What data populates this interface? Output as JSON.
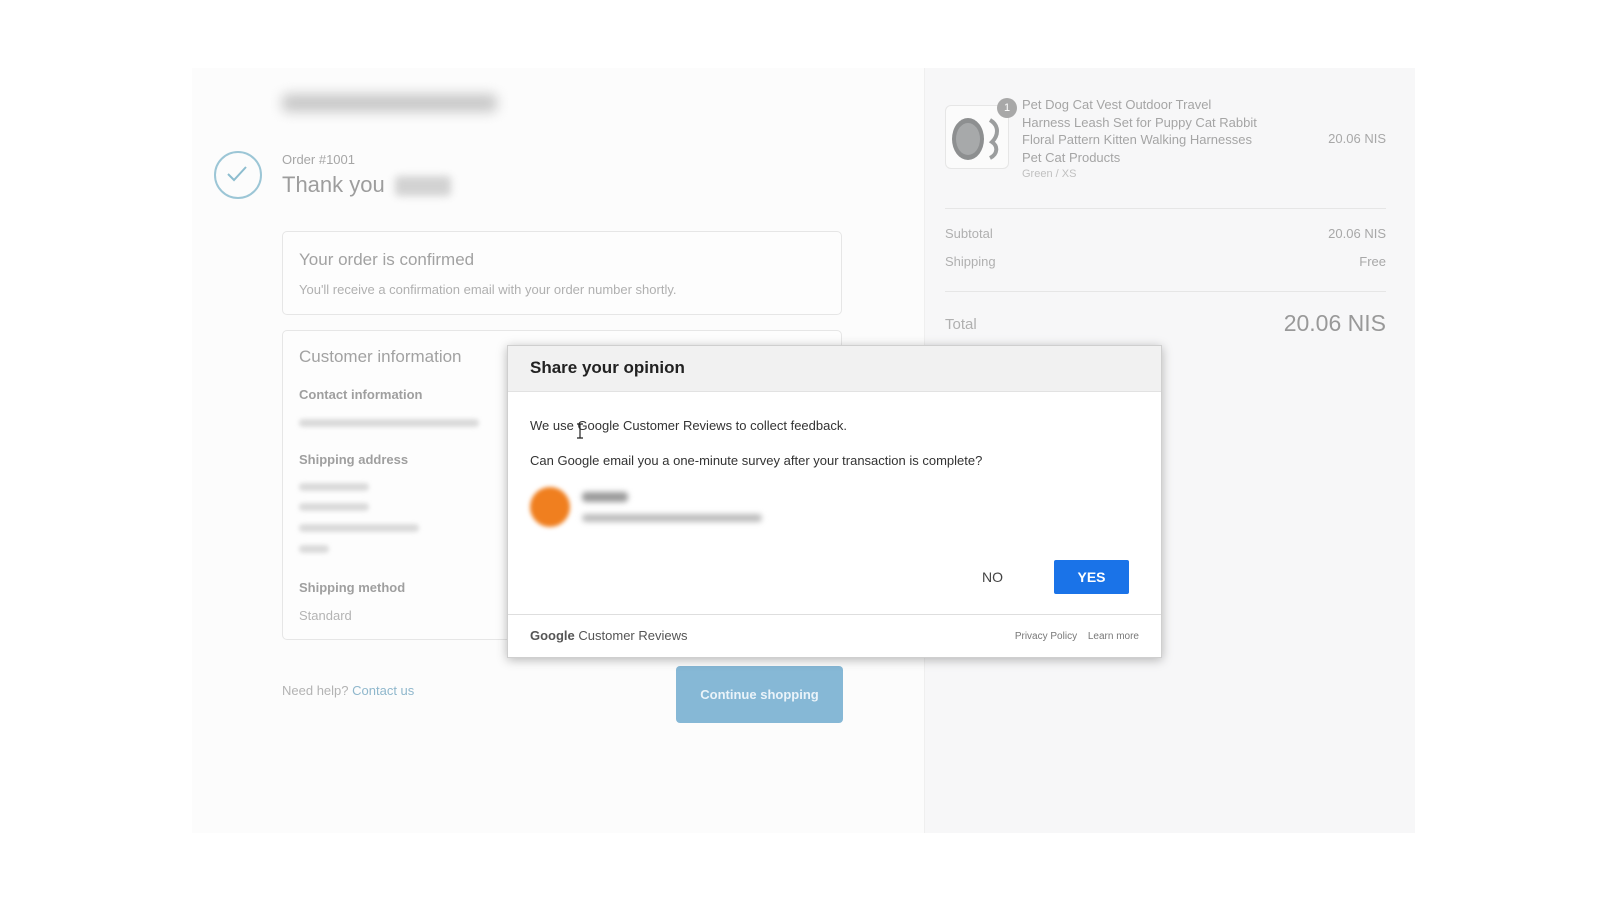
{
  "left": {
    "order_number": "Order #1001",
    "thanks": "Thank you",
    "confirm": {
      "title": "Your order is confirmed",
      "text": "You'll receive a confirmation email with your order number shortly."
    },
    "customer": {
      "title": "Customer information",
      "contact_label": "Contact information",
      "shipping_address_label": "Shipping address",
      "shipping_method_label": "Shipping method",
      "shipping_method_value": "Standard"
    },
    "help_text": "Need help?",
    "contact_link": "Contact us",
    "continue_label": "Continue shopping"
  },
  "summary": {
    "quantity": "1",
    "product_name": "Pet Dog Cat Vest Outdoor Travel Harness Leash Set for Puppy Cat Rabbit Floral Pattern Kitten Walking Harnesses Pet Cat Products",
    "variant": "Green / XS",
    "price": "20.06 NIS",
    "subtotal_label": "Subtotal",
    "subtotal_value": "20.06 NIS",
    "shipping_label": "Shipping",
    "shipping_value": "Free",
    "total_label": "Total",
    "total_value": "20.06 NIS"
  },
  "modal": {
    "title": "Share your opinion",
    "line1": "We use Google Customer Reviews to collect feedback.",
    "line2": "Can Google email you a one-minute survey after your transaction is complete?",
    "no_label": "NO",
    "yes_label": "YES",
    "footer_brand_1": "Google",
    "footer_brand_2": "Customer Reviews",
    "privacy_label": "Privacy Policy",
    "learn_label": "Learn more"
  },
  "colors": {
    "accent_blue": "#1a73e8",
    "continue_button": "#86b8d6",
    "avatar": "#f07f1f"
  }
}
